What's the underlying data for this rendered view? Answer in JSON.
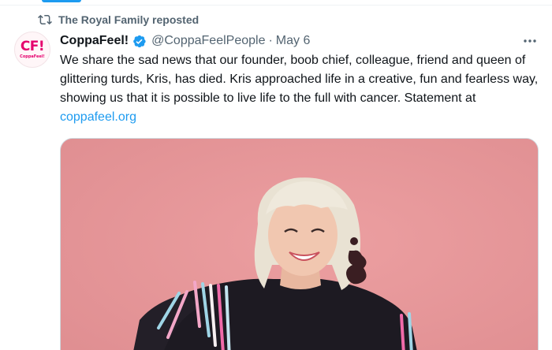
{
  "repost": {
    "icon": "repost-icon",
    "text": "The Royal Family reposted"
  },
  "author": {
    "avatar_logo": "CF!",
    "avatar_sub": "CoppaFeel!",
    "name": "CoppaFeel!",
    "verified_icon": "verified-badge-icon",
    "handle": "@CoppaFeelPeople",
    "separator": "·",
    "date": "May 6"
  },
  "more_icon": "more-options-icon",
  "tweet": {
    "text": "We share the sad news that our founder, boob chief, colleague, friend and queen of glittering turds, Kris, has died. Kris approached life in a creative, fun and fearless way, showing us that it is possible to live life to the full with cancer. Statement at ",
    "link": "coppafeel.org"
  },
  "media": {
    "description_icon": "photo",
    "colors": {
      "background": "#e79a9c",
      "hair": "#ede6d6",
      "skin": "#f1c7b0",
      "sweater": "#1d1a22"
    }
  },
  "colors": {
    "accent": "#1d9bf0",
    "text": "#0f1419",
    "secondary": "#536471"
  }
}
